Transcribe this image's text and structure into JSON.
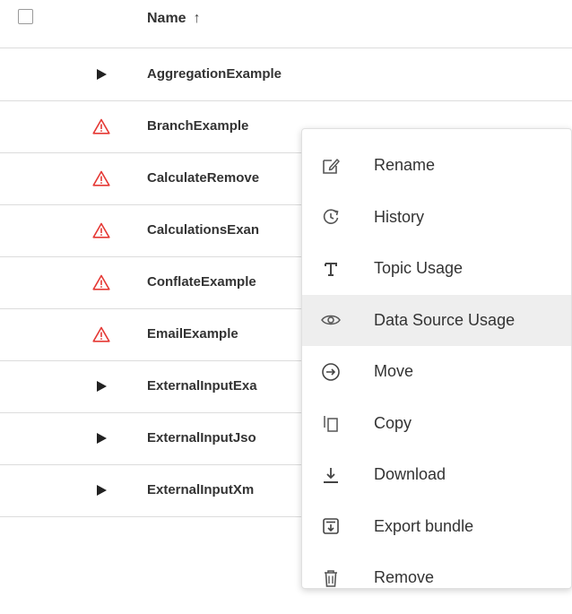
{
  "header": {
    "name_label": "Name",
    "sort_icon": "↑"
  },
  "rows": [
    {
      "name": "AggregationExample",
      "status": "play-icon"
    },
    {
      "name": "BranchExample",
      "status": "warning-icon"
    },
    {
      "name": "CalculateRemove",
      "status": "warning-icon"
    },
    {
      "name": "CalculationsExan",
      "status": "warning-icon"
    },
    {
      "name": "ConflateExample",
      "status": "warning-icon"
    },
    {
      "name": "EmailExample",
      "status": "warning-icon"
    },
    {
      "name": "ExternalInputExa",
      "status": "play-icon"
    },
    {
      "name": "ExternalInputJso",
      "status": "play-icon"
    },
    {
      "name": "ExternalInputXm",
      "status": "play-icon"
    }
  ],
  "menu": {
    "items": [
      {
        "label": "Rename",
        "icon": "edit-icon"
      },
      {
        "label": "History",
        "icon": "history-icon"
      },
      {
        "label": "Topic Usage",
        "icon": "text-icon"
      },
      {
        "label": "Data Source Usage",
        "icon": "eye-icon"
      },
      {
        "label": "Move",
        "icon": "arrow-right-circle-icon"
      },
      {
        "label": "Copy",
        "icon": "copy-icon"
      },
      {
        "label": "Download",
        "icon": "download-icon"
      },
      {
        "label": "Export bundle",
        "icon": "export-icon"
      },
      {
        "label": "Remove",
        "icon": "trash-icon"
      }
    ],
    "highlighted_index": 3
  },
  "colors": {
    "warning": "#e53935",
    "border": "#dcdcdc",
    "highlight": "#eeeeee"
  }
}
